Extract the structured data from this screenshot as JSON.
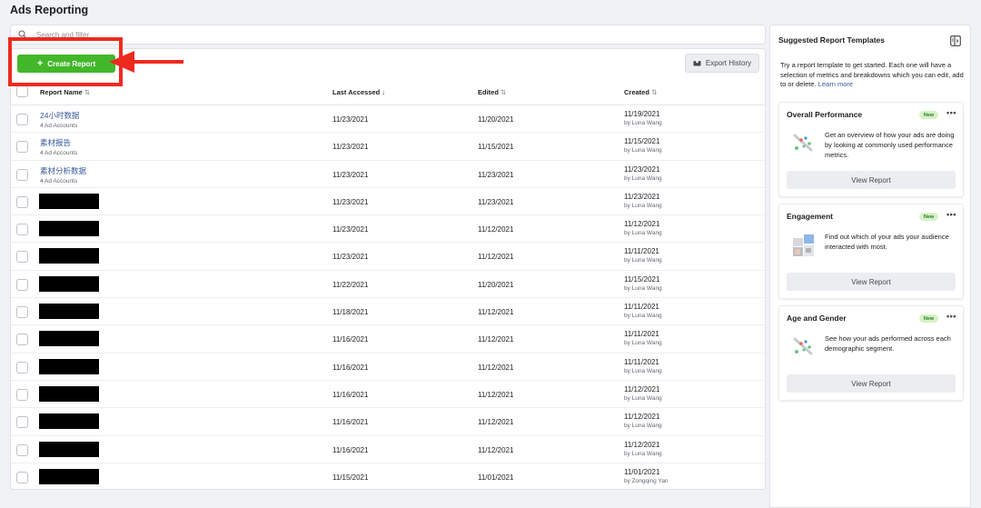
{
  "page_title": "Ads Reporting",
  "search": {
    "placeholder": "Search and filter"
  },
  "toolbar": {
    "create_label": "Create Report",
    "export_label": "Export History"
  },
  "table": {
    "headers": {
      "name": "Report Name",
      "last_accessed": "Last Accessed",
      "edited": "Edited",
      "created": "Created"
    },
    "rows": [
      {
        "name": "24小时数据",
        "sub": "4 Ad Accounts",
        "last_accessed": "11/23/2021",
        "edited": "11/20/2021",
        "created": "11/19/2021",
        "created_by": "by Luna Wang"
      },
      {
        "name": "素材报告",
        "sub": "4 Ad Accounts",
        "last_accessed": "11/23/2021",
        "edited": "11/15/2021",
        "created": "11/15/2021",
        "created_by": "by Luna Wang"
      },
      {
        "name": "素材分析数据",
        "sub": "4 Ad Accounts",
        "last_accessed": "11/23/2021",
        "edited": "11/23/2021",
        "created": "11/23/2021",
        "created_by": "by Luna Wang"
      },
      {
        "name": "",
        "sub": "",
        "last_accessed": "11/23/2021",
        "edited": "11/23/2021",
        "created": "11/23/2021",
        "created_by": "by Luna Wang"
      },
      {
        "name": "",
        "sub": "",
        "last_accessed": "11/23/2021",
        "edited": "11/12/2021",
        "created": "11/12/2021",
        "created_by": "by Luna Wang"
      },
      {
        "name": "",
        "sub": "",
        "last_accessed": "11/23/2021",
        "edited": "11/12/2021",
        "created": "11/11/2021",
        "created_by": "by Luna Wang"
      },
      {
        "name": "",
        "sub": "",
        "last_accessed": "11/22/2021",
        "edited": "11/20/2021",
        "created": "11/15/2021",
        "created_by": "by Luna Wang"
      },
      {
        "name": "",
        "sub": "",
        "last_accessed": "11/18/2021",
        "edited": "11/12/2021",
        "created": "11/11/2021",
        "created_by": "by Luna Wang"
      },
      {
        "name": "",
        "sub": "",
        "last_accessed": "11/16/2021",
        "edited": "11/12/2021",
        "created": "11/11/2021",
        "created_by": "by Luna Wang"
      },
      {
        "name": "",
        "sub": "",
        "last_accessed": "11/16/2021",
        "edited": "11/12/2021",
        "created": "11/11/2021",
        "created_by": "by Luna Wang"
      },
      {
        "name": "",
        "sub": "",
        "last_accessed": "11/16/2021",
        "edited": "11/12/2021",
        "created": "11/12/2021",
        "created_by": "by Luna Wang"
      },
      {
        "name": "",
        "sub": "",
        "last_accessed": "11/16/2021",
        "edited": "11/12/2021",
        "created": "11/12/2021",
        "created_by": "by Luna Wang"
      },
      {
        "name": "",
        "sub": "",
        "last_accessed": "11/16/2021",
        "edited": "11/12/2021",
        "created": "11/12/2021",
        "created_by": "by Luna Wang"
      },
      {
        "name": "",
        "sub": "",
        "last_accessed": "11/15/2021",
        "edited": "11/01/2021",
        "created": "11/01/2021",
        "created_by": "by Zongqing Yan"
      }
    ]
  },
  "side_panel": {
    "title": "Suggested Report Templates",
    "description": "Try a report template to get started. Each one will have a selection of metrics and breakdowns which you can edit, add to or delete.",
    "learn_more": "Learn more",
    "templates": [
      {
        "title": "Overall Performance",
        "badge": "New",
        "description": "Get an overview of how your ads are doing by looking at commonly used performance metrics.",
        "button": "View Report",
        "icon": "scatter-chart-icon"
      },
      {
        "title": "Engagement",
        "badge": "New",
        "description": "Find out which of your ads your audience interacted with most.",
        "button": "View Report",
        "icon": "image-grid-icon"
      },
      {
        "title": "Age and Gender",
        "badge": "New",
        "description": "See how your ads performed across each demographic segment.",
        "button": "View Report",
        "icon": "scatter-chart-icon"
      }
    ]
  },
  "colors": {
    "create_button": "#42b72a",
    "highlight": "#ee2a1e",
    "link": "#385898",
    "badge_bg": "#d6f2c4"
  }
}
